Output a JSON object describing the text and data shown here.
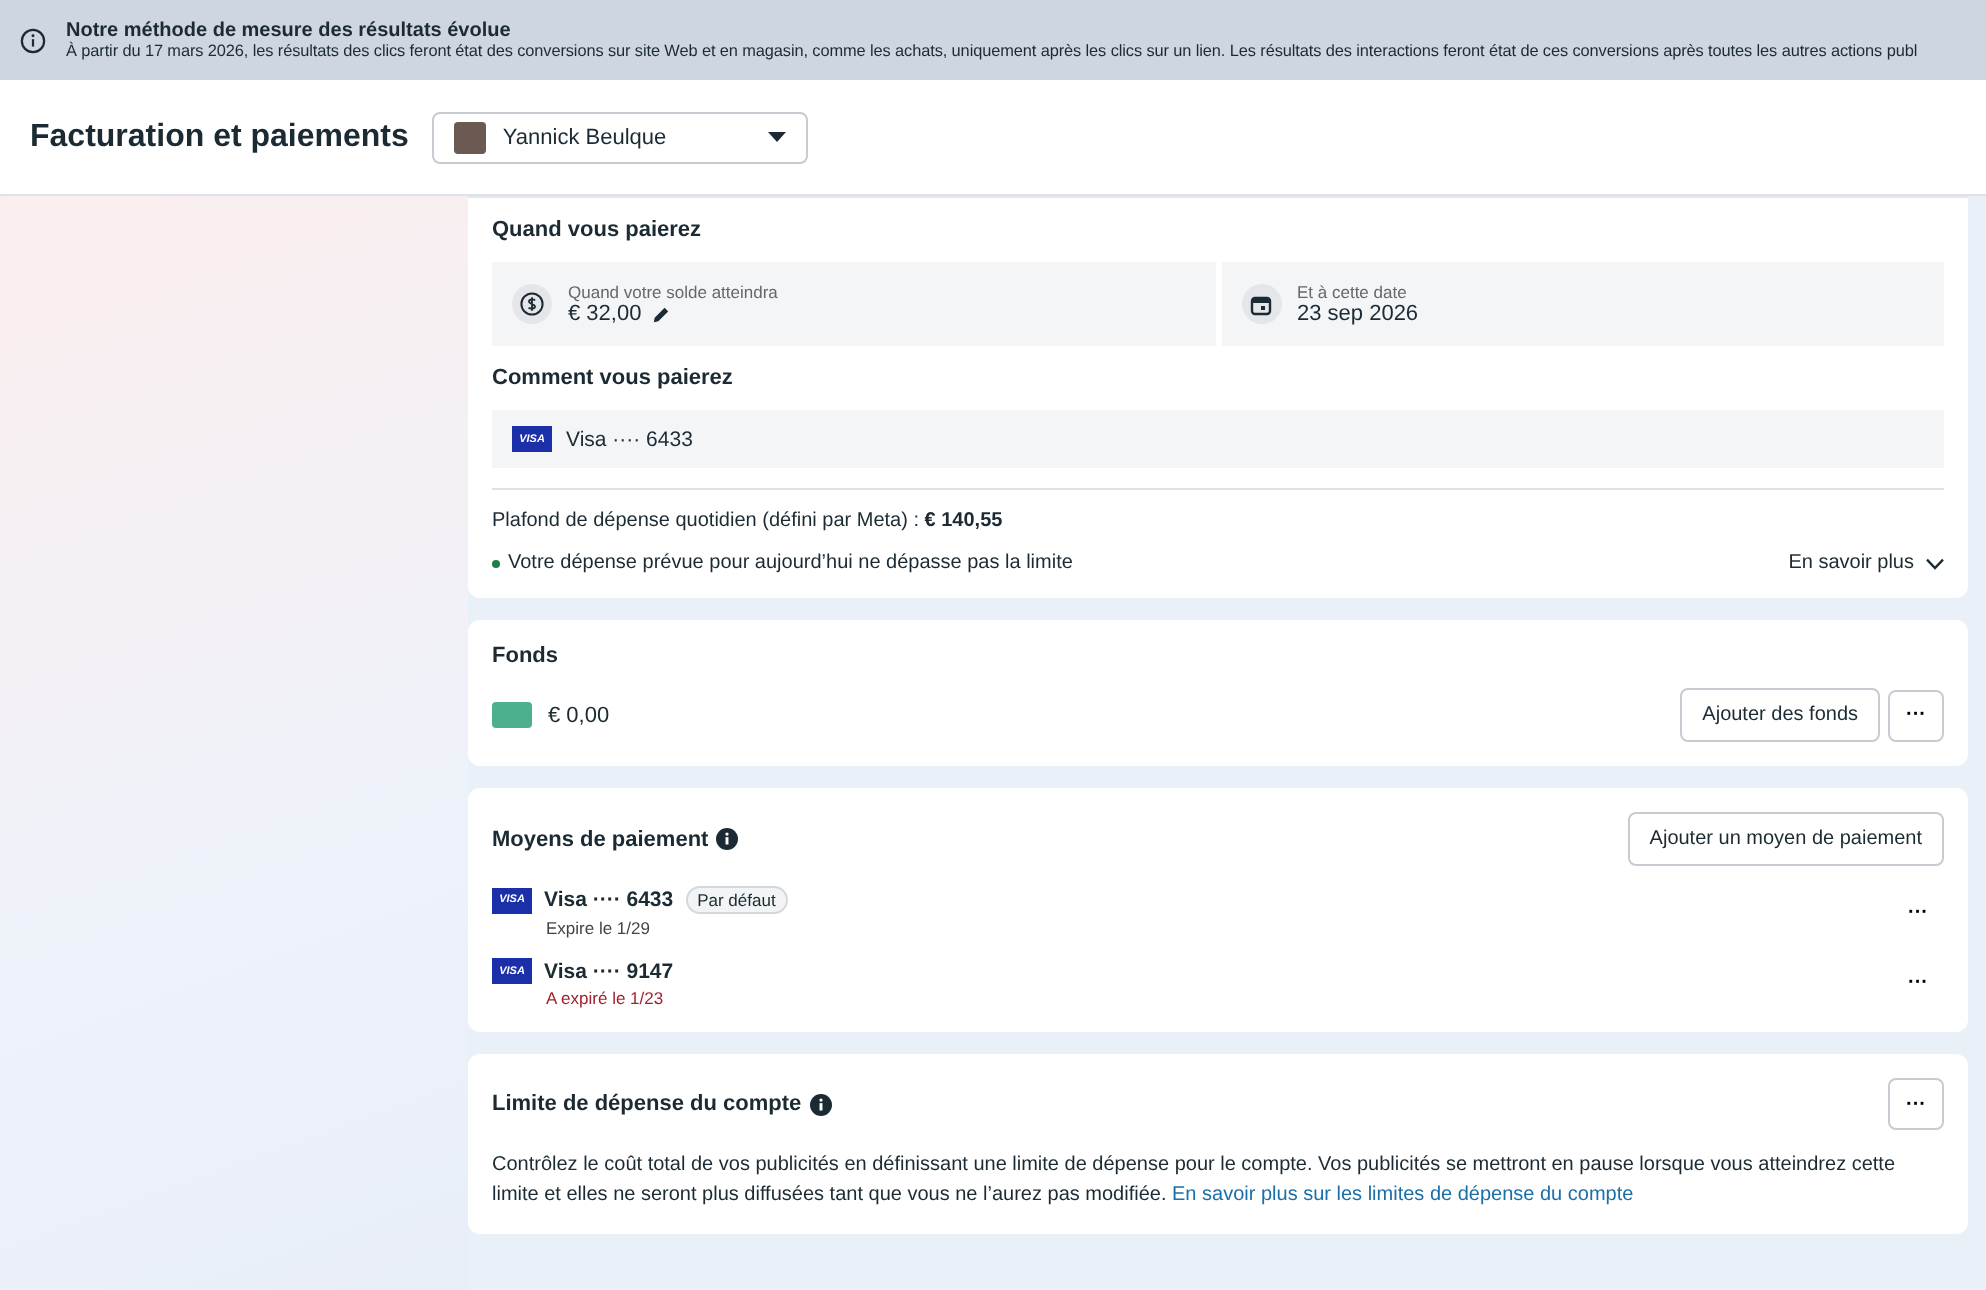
{
  "banner": {
    "title": "Notre méthode de mesure des résultats évolue",
    "text": "À partir du 17 mars 2026, les résultats des clics feront état des conversions sur site Web et en magasin, comme les achats, uniquement après les clics sur un lien. Les résultats des interactions feront état de ces conversions après toutes les autres actions publ"
  },
  "header": {
    "title": "Facturation et paiements",
    "account": "Yannick Beulque"
  },
  "payment_card": {
    "when_title": "Quand vous paierez",
    "threshold": {
      "label": "Quand votre solde atteindra",
      "value": "€ 32,00"
    },
    "date": {
      "label": "Et à cette date",
      "value": "23 sep 2026"
    },
    "how_title": "Comment vous paierez",
    "method": {
      "brand": "VISA",
      "label": "Visa ···· 6433"
    },
    "daily_limit": "Plafond de dépense quotidien (défini par Meta) : **€ 140,55**",
    "status": {
      "text": "Votre dépense prévue pour aujourd’hui ne dépasse pas la limite",
      "color": "#1e7d4a"
    },
    "learn_more": "En savoir plus"
  },
  "funds": {
    "title": "Fonds",
    "amount": "€ 0,00",
    "add_button": "Ajouter des fonds",
    "more": "···"
  },
  "payment_methods": {
    "title": "Moyens de paiement",
    "add_button": "Ajouter un moyen de paiement",
    "items": [
      {
        "brand": "VISA",
        "label": "Visa ···· 6433",
        "badge": "Par défaut",
        "expiry": "Expire le 1/29",
        "expired": false,
        "more": "···"
      },
      {
        "brand": "VISA",
        "label": "Visa ···· 9147",
        "expiry": "A expiré le 1/23",
        "expired": true,
        "more": "···"
      }
    ]
  },
  "account_limit": {
    "title": "Limite de dépense du compte",
    "more": "···",
    "text": "Contrôlez le coût total de vos publicités en définissant une limite de dépense pour le compte. Vos publicités se mettront en pause lorsque vous atteindrez cette limite et elles ne seront plus diffusées tant que vous ne l’aurez pas modifiée.",
    "link": "En savoir plus sur les limites de dépense du compte"
  }
}
